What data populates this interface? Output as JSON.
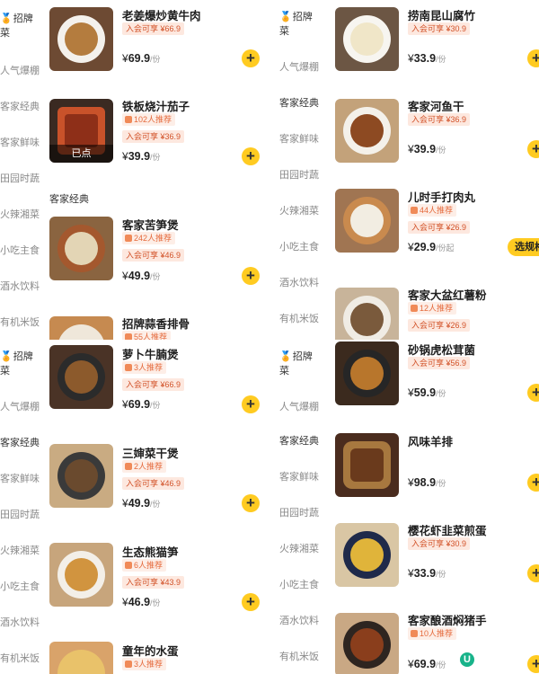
{
  "colors": {
    "accent": "#ffcb21",
    "tag_text": "#d2532a",
    "tag_bg": "#fde8df"
  },
  "price_unit": "/份",
  "price_unit_alt": "/份起",
  "currency": "¥",
  "done_label": "已点",
  "spec_button": "选规格",
  "left_sidebar_top": [
    "招牌",
    "菜",
    "人气爆棚"
  ],
  "left_sidebar_bottom": [
    "招牌",
    "菜",
    "人气爆棚",
    "客家经典",
    "客家鲜味",
    "田园时蔬",
    "火辣湘菜",
    "小吃主食",
    "酒水饮料",
    "有机米饭"
  ],
  "left_sidebar_mid": [
    "客家经典",
    "客家鲜味",
    "田园时蔬",
    "火辣湘菜",
    "小吃主食",
    "酒水饮料",
    "有机米饭"
  ],
  "right_sidebar_top": [
    "招牌",
    "菜",
    "人气爆棚",
    "客家经典",
    "客家鲜味",
    "田园时蔬",
    "火辣湘菜",
    "小吃主食",
    "酒水饮料",
    "有机米饭"
  ],
  "right_sidebar_bottom": [
    "招牌",
    "菜",
    "人气爆棚",
    "客家经典",
    "客家鲜味",
    "田园时蔬",
    "火辣湘菜",
    "小吃主食",
    "酒水饮料",
    "有机米饭"
  ],
  "section_hakka": "客家经典",
  "left_top": [
    {
      "name": "老姜爆炒黄牛肉",
      "member": "入会可享 ¥66.9",
      "price": "69.9"
    },
    {
      "name": "铁板烧汁茄子",
      "rec": "102人推荐",
      "member": "入会可享 ¥36.9",
      "price": "39.9"
    },
    {
      "name": "客家苦笋煲",
      "rec": "242人推荐",
      "member": "入会可享 ¥46.9",
      "price": "49.9"
    },
    {
      "name": "招牌蒜香排骨",
      "rec": "55人推荐"
    }
  ],
  "left_bottom": [
    {
      "name": "萝卜牛腩煲",
      "rec": "3人推荐",
      "member": "入会可享 ¥66.9",
      "price": "69.9"
    },
    {
      "name": "三婶菜干煲",
      "rec": "2人推荐",
      "member": "入会可享 ¥46.9",
      "price": "49.9"
    },
    {
      "name": "生态熊猫笋",
      "rec": "6人推荐",
      "member": "入会可享 ¥43.9",
      "price": "46.9"
    },
    {
      "name": "童年的水蛋",
      "rec": "3人推荐"
    }
  ],
  "right_top": [
    {
      "name": "捞南昆山腐竹",
      "member": "入会可享 ¥30.9",
      "price": "33.9"
    },
    {
      "name": "客家河鱼干",
      "member": "入会可享 ¥36.9",
      "price": "39.9"
    },
    {
      "name": "儿时手打肉丸",
      "rec": "44人推荐",
      "member": "入会可享 ¥26.9",
      "price": "29.9"
    },
    {
      "name": "客家大盆红薯粉",
      "rec": "12人推荐",
      "member": "入会可享 ¥26.9"
    }
  ],
  "right_bottom": [
    {
      "name": "砂锅虎松茸菌",
      "member": "入会可享 ¥56.9",
      "price": "59.9"
    },
    {
      "name": "风味羊排",
      "price": "98.9"
    },
    {
      "name": "樱花虾韭菜煎蛋",
      "member": "入会可享 ¥30.9",
      "price": "33.9"
    },
    {
      "name": "客家酿酒焖猪手",
      "rec": "10人推荐",
      "price": "69.9"
    }
  ],
  "float_logo": "U"
}
